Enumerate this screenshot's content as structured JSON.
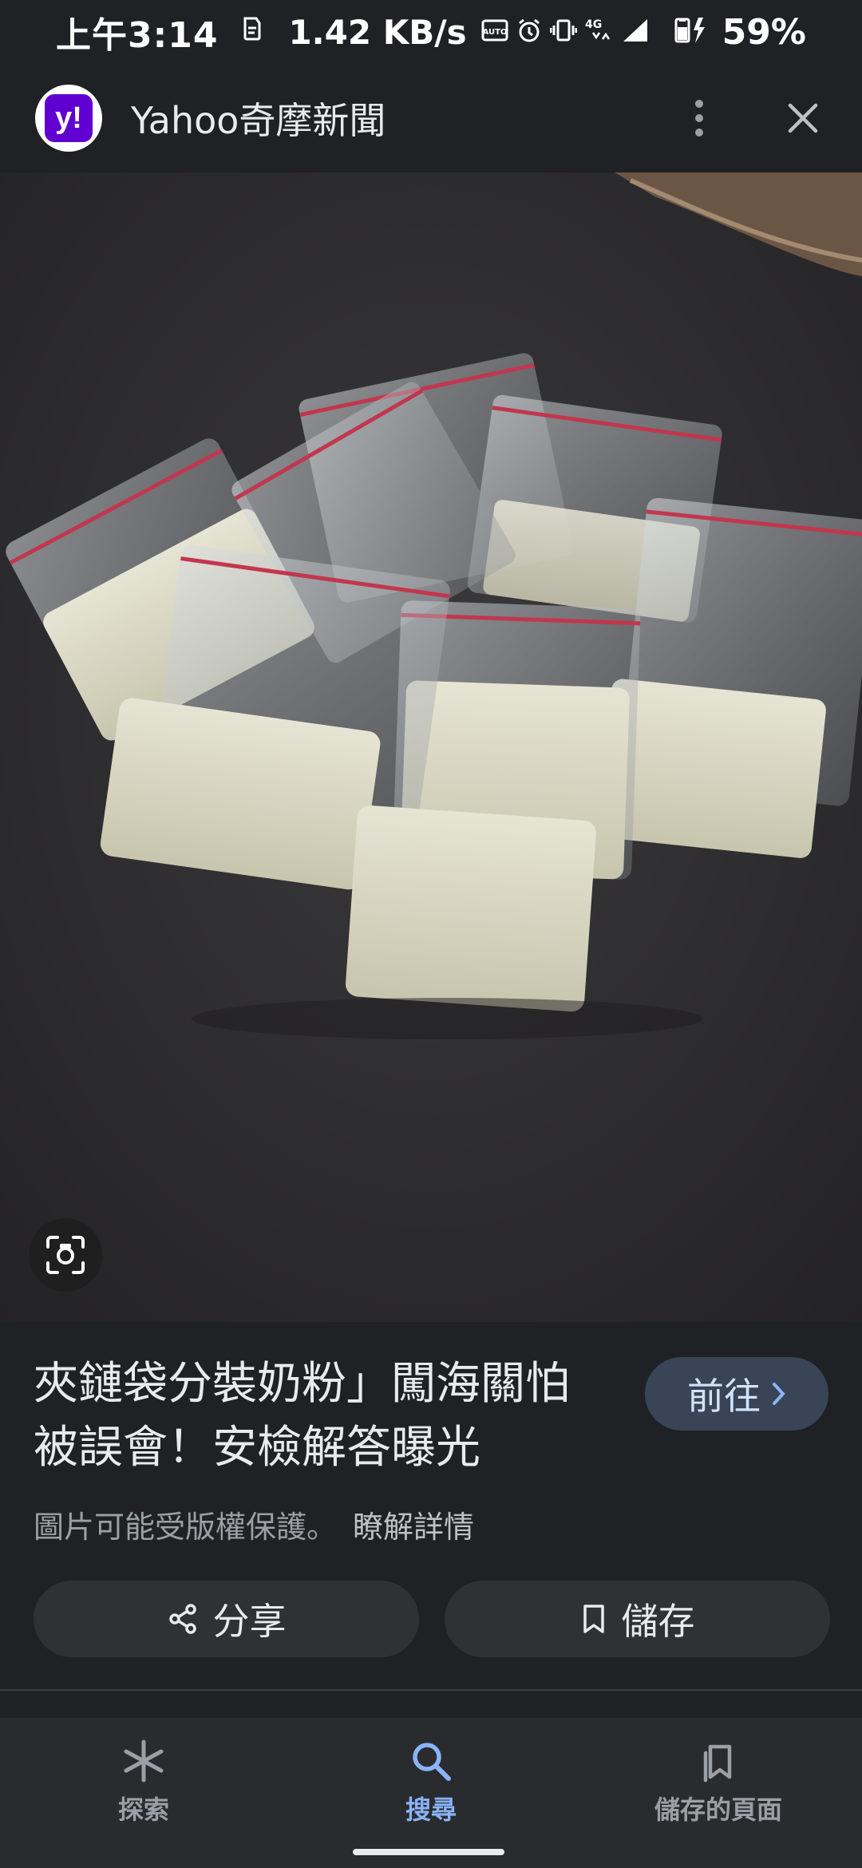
{
  "status_bar": {
    "time": "上午3:14",
    "network_speed": "1.42 KB/s",
    "network_type": "4G",
    "battery_percent": "59%"
  },
  "header": {
    "logo_text": "y!",
    "site_title": "Yahoo奇摩新聞"
  },
  "result": {
    "headline": "夾鏈袋分裝奶粉」闖海關怕被誤會！安檢解答曝光",
    "visit_label": "前往",
    "copyright_notice": "圖片可能受版權保護。",
    "learn_more_label": "瞭解詳情",
    "share_label": "分享",
    "save_label": "儲存"
  },
  "bottom_nav": {
    "items": [
      {
        "label": "探索",
        "icon": "asterisk-icon",
        "active": false
      },
      {
        "label": "搜尋",
        "icon": "search-icon",
        "active": true
      },
      {
        "label": "儲存的頁面",
        "icon": "saved-pages-icon",
        "active": false
      }
    ]
  },
  "colors": {
    "background": "#202124",
    "accent": "#8ab4f8",
    "yahoo_purple": "#6001d2",
    "visit_button": "#394457"
  }
}
